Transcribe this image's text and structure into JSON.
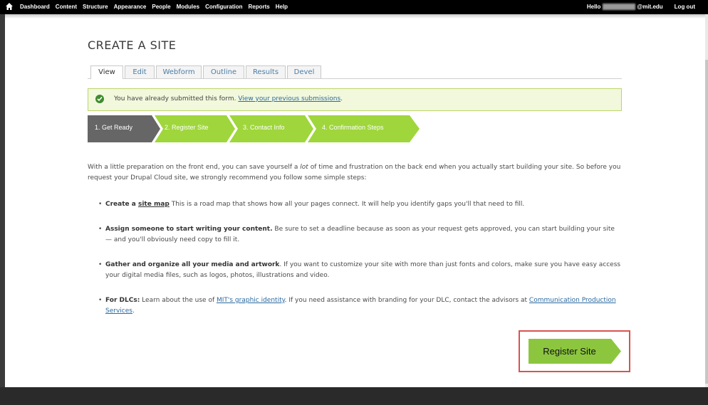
{
  "toolbar": {
    "menu": [
      "Dashboard",
      "Content",
      "Structure",
      "Appearance",
      "People",
      "Modules",
      "Configuration",
      "Reports",
      "Help"
    ],
    "hello": "Hello",
    "email_suffix": "@mit.edu",
    "logout": "Log out"
  },
  "page": {
    "title": "CREATE A SITE"
  },
  "tabs": [
    "View",
    "Edit",
    "Webform",
    "Outline",
    "Results",
    "Devel"
  ],
  "message": {
    "text": "You have already submitted this form.",
    "link": "View your previous submissions",
    "end": "."
  },
  "steps": [
    "1. Get Ready",
    "2. Register Site",
    "3. Contact Info",
    "4. Confirmation Steps"
  ],
  "intro": {
    "part1": "With a little preparation on the front end, you can save yourself a ",
    "em": "lot",
    "part2": " of time and frustration on the back end when you actually start building your site. So before you request your Drupal Cloud site, we strongly recommend you follow some simple steps:"
  },
  "list": [
    {
      "bold": "Create a ",
      "link": "site map",
      "rest": " This is a road map that shows how all your pages connect. It will help you identify gaps you'll that need to fill."
    },
    {
      "bold": "Assign someone to start writing your content.",
      "rest": " Be sure to set a deadline because as soon as your request gets approved, you can start building your site — and you'll obviously need copy to fill it."
    },
    {
      "bold": "Gather and organize all your media and artwork",
      "rest": ". If you want to customize your site with more than just fonts and colors, make sure you have easy access your digital media files, such as logos, photos, illustrations and video."
    },
    {
      "bold": "For DLCs:",
      "rest1": " Learn about the use of ",
      "link1": "MIT's graphic identity",
      "rest2": ". If you need assistance with branding for your DLC, contact the advisors at ",
      "link2": "Communication Production Services",
      "rest3": "."
    }
  ],
  "button": {
    "label": "Register Site"
  },
  "colors": {
    "active_step": "#666666",
    "step_green": "#9fd63c",
    "button_green": "#8cc63f",
    "highlight": "#d9534f"
  }
}
